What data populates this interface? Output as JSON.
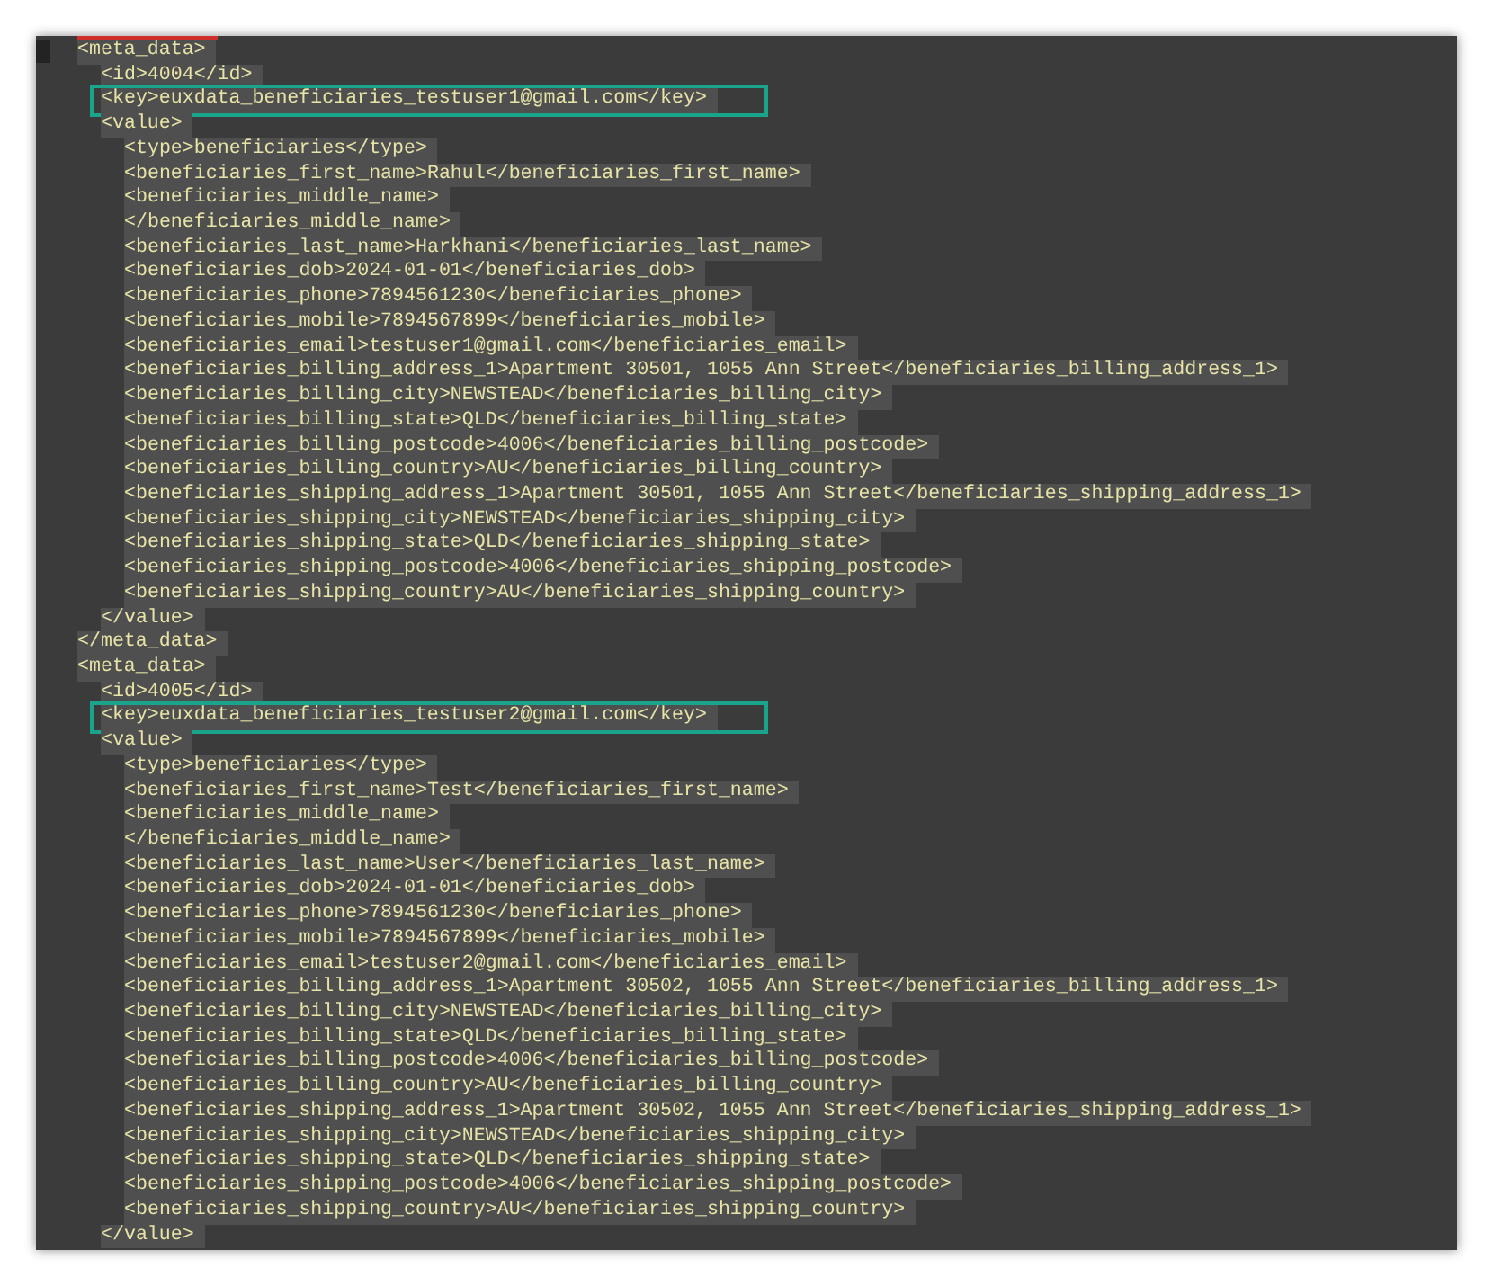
{
  "lines": [
    {
      "text": "<meta_data>",
      "closing": "</meta_data>",
      "children": [
        {
          "text": "<id>4004</id>"
        },
        {
          "text": "<key>euxdata_beneficiaries_testuser1@gmail.com</key>",
          "highlighted": true
        },
        {
          "text": "<value>",
          "closing": "</value>",
          "children": [
            {
              "text": "<type>beneficiaries</type>"
            },
            {
              "text": "<beneficiaries_first_name>Rahul</beneficiaries_first_name>"
            },
            {
              "text": "<beneficiaries_middle_name>"
            },
            {
              "text": "</beneficiaries_middle_name>"
            },
            {
              "text": "<beneficiaries_last_name>Harkhani</beneficiaries_last_name>"
            },
            {
              "text": "<beneficiaries_dob>2024-01-01</beneficiaries_dob>"
            },
            {
              "text": "<beneficiaries_phone>7894561230</beneficiaries_phone>"
            },
            {
              "text": "<beneficiaries_mobile>7894567899</beneficiaries_mobile>"
            },
            {
              "text": "<beneficiaries_email>testuser1@gmail.com</beneficiaries_email>"
            },
            {
              "text": "<beneficiaries_billing_address_1>Apartment 30501, 1055 Ann Street</beneficiaries_billing_address_1>"
            },
            {
              "text": "<beneficiaries_billing_city>NEWSTEAD</beneficiaries_billing_city>"
            },
            {
              "text": "<beneficiaries_billing_state>QLD</beneficiaries_billing_state>"
            },
            {
              "text": "<beneficiaries_billing_postcode>4006</beneficiaries_billing_postcode>"
            },
            {
              "text": "<beneficiaries_billing_country>AU</beneficiaries_billing_country>"
            },
            {
              "text": "<beneficiaries_shipping_address_1>Apartment 30501, 1055 Ann Street</beneficiaries_shipping_address_1>"
            },
            {
              "text": "<beneficiaries_shipping_city>NEWSTEAD</beneficiaries_shipping_city>"
            },
            {
              "text": "<beneficiaries_shipping_state>QLD</beneficiaries_shipping_state>"
            },
            {
              "text": "<beneficiaries_shipping_postcode>4006</beneficiaries_shipping_postcode>"
            },
            {
              "text": "<beneficiaries_shipping_country>AU</beneficiaries_shipping_country>"
            }
          ]
        }
      ]
    },
    {
      "text": "<meta_data>",
      "children": [
        {
          "text": "<id>4005</id>"
        },
        {
          "text": "<key>euxdata_beneficiaries_testuser2@gmail.com</key>",
          "highlighted": true
        },
        {
          "text": "<value>",
          "closing": "</value>",
          "children": [
            {
              "text": "<type>beneficiaries</type>"
            },
            {
              "text": "<beneficiaries_first_name>Test</beneficiaries_first_name>"
            },
            {
              "text": "<beneficiaries_middle_name>"
            },
            {
              "text": "</beneficiaries_middle_name>"
            },
            {
              "text": "<beneficiaries_last_name>User</beneficiaries_last_name>"
            },
            {
              "text": "<beneficiaries_dob>2024-01-01</beneficiaries_dob>"
            },
            {
              "text": "<beneficiaries_phone>7894561230</beneficiaries_phone>"
            },
            {
              "text": "<beneficiaries_mobile>7894567899</beneficiaries_mobile>"
            },
            {
              "text": "<beneficiaries_email>testuser2@gmail.com</beneficiaries_email>"
            },
            {
              "text": "<beneficiaries_billing_address_1>Apartment 30502, 1055 Ann Street</beneficiaries_billing_address_1>"
            },
            {
              "text": "<beneficiaries_billing_city>NEWSTEAD</beneficiaries_billing_city>"
            },
            {
              "text": "<beneficiaries_billing_state>QLD</beneficiaries_billing_state>"
            },
            {
              "text": "<beneficiaries_billing_postcode>4006</beneficiaries_billing_postcode>"
            },
            {
              "text": "<beneficiaries_billing_country>AU</beneficiaries_billing_country>"
            },
            {
              "text": "<beneficiaries_shipping_address_1>Apartment 30502, 1055 Ann Street</beneficiaries_shipping_address_1>"
            },
            {
              "text": "<beneficiaries_shipping_city>NEWSTEAD</beneficiaries_shipping_city>"
            },
            {
              "text": "<beneficiaries_shipping_state>QLD</beneficiaries_shipping_state>"
            },
            {
              "text": "<beneficiaries_shipping_postcode>4006</beneficiaries_shipping_postcode>"
            },
            {
              "text": "<beneficiaries_shipping_country>AU</beneficiaries_shipping_country>"
            }
          ]
        }
      ]
    }
  ]
}
